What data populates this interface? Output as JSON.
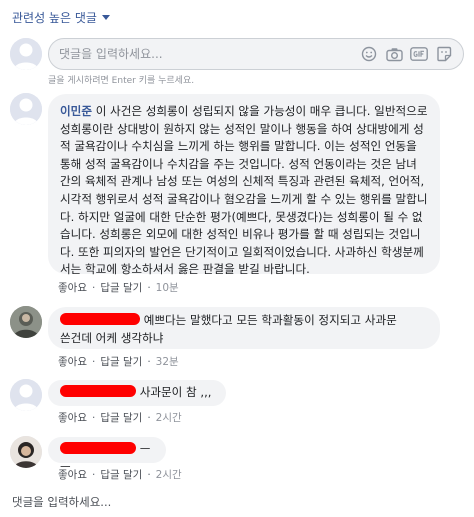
{
  "sort": {
    "label": "관련성 높은 댓글",
    "icon": "caret-down-icon"
  },
  "composer": {
    "placeholder": "댓글을 입력하세요...",
    "hint": "글을 게시하려면 Enter 키를 누르세요.",
    "tools": [
      "emoji-icon",
      "camera-icon",
      "gif-icon",
      "sticker-icon"
    ]
  },
  "comments": [
    {
      "author": "이민준",
      "text": "이 사건은 성희롱이 성립되지 않을 가능성이 매우 큽니다. 일반적으로 성희롱이란 상대방이 원하지 않는 성적인 말이나 행동을 하여 상대방에게 성적 굴욕감이나 수치심을 느끼게 하는 행위를 말합니다. 이는 성적인 언동을 통해 성적 굴욕감이나 수치감을 주는 것입니다. 성적 언동이라는 것은 남녀 간의 육체적 관계나 남성 또는 여성의 신체적 특징과 관련된 육체적, 언어적, 시각적 행위로서 성적 굴욕감이나 혐오감을 느끼게 할 수 있는 행위를 말합니다. 하지만 얼굴에 대한 단순한 평가(예쁘다, 못생겼다)는 성희롱이 될 수 없습니다. 성희롱은 외모에 대한 성적인 비유나 평가를 할 때 성립되는 것입니다. 또한 피의자의 발언은 단기적이고 일회적이었습니다. 사과하신 학생분께서는 학교에 항소하셔서 옳은 판결을 받길 바랍니다.",
      "like": "좋아요",
      "reply": "답글 달기",
      "time": "10분"
    },
    {
      "text_line1": "예쁘다는 말했다고 모든 학과활동이 정지되고 사과문",
      "text_line2": "쓴건데 어케 생각하냐",
      "like": "좋아요",
      "reply": "답글 달기",
      "time": "32분"
    },
    {
      "text": "사과문이 참 ,,,",
      "like": "좋아요",
      "reply": "답글 달기",
      "time": "2시간"
    },
    {
      "text": "ㅡㅡ",
      "like": "좋아요",
      "reply": "답글 달기",
      "time": "2시간"
    }
  ],
  "reply_composer": {
    "placeholder": "댓글을 입력하세요..."
  },
  "colors": {
    "link": "#385898",
    "bubble": "#f2f3f5",
    "meta": "#606770",
    "redaction": "#ff0000"
  }
}
